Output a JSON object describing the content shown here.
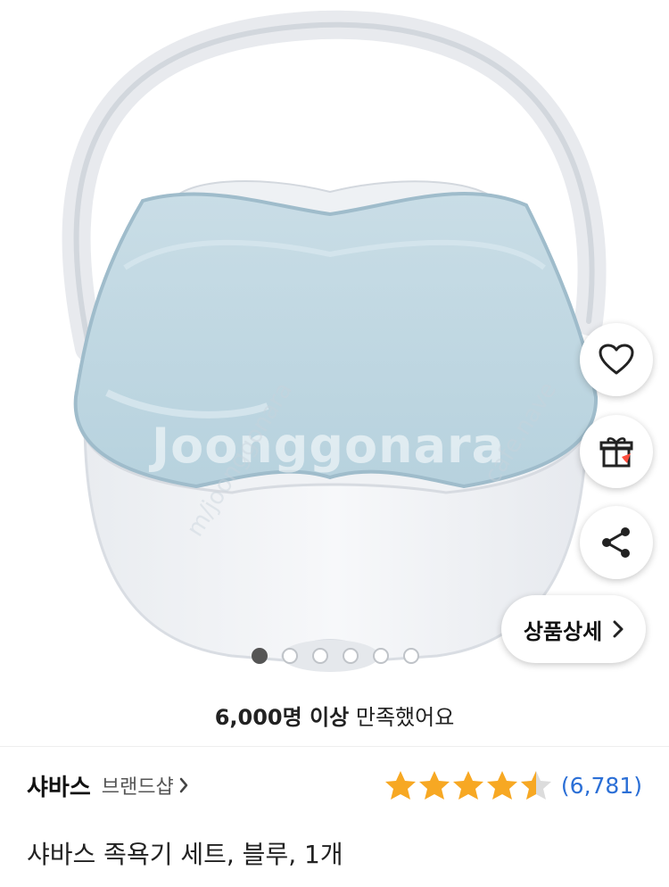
{
  "hero": {
    "watermark": "Joonggonara",
    "watermark_diag_left": "m/joonggonara",
    "watermark_diag_right": "cafe.nave"
  },
  "actions": {
    "wishlist_icon": "heart-icon",
    "gift_icon": "gift-icon",
    "share_icon": "share-icon",
    "detail_label": "상품상세"
  },
  "carousel": {
    "total": 6,
    "active_index": 0
  },
  "satisfaction": {
    "count_text": "6,000명 이상",
    "suffix": "만족했어요"
  },
  "brand": {
    "name": "샤바스",
    "shop_label": "브랜드샵"
  },
  "rating": {
    "stars": 4.5,
    "max": 5,
    "count": "(6,781)",
    "star_color": "#f7a823"
  },
  "product": {
    "title": "샤바스 족욕기 세트, 블루, 1개"
  }
}
